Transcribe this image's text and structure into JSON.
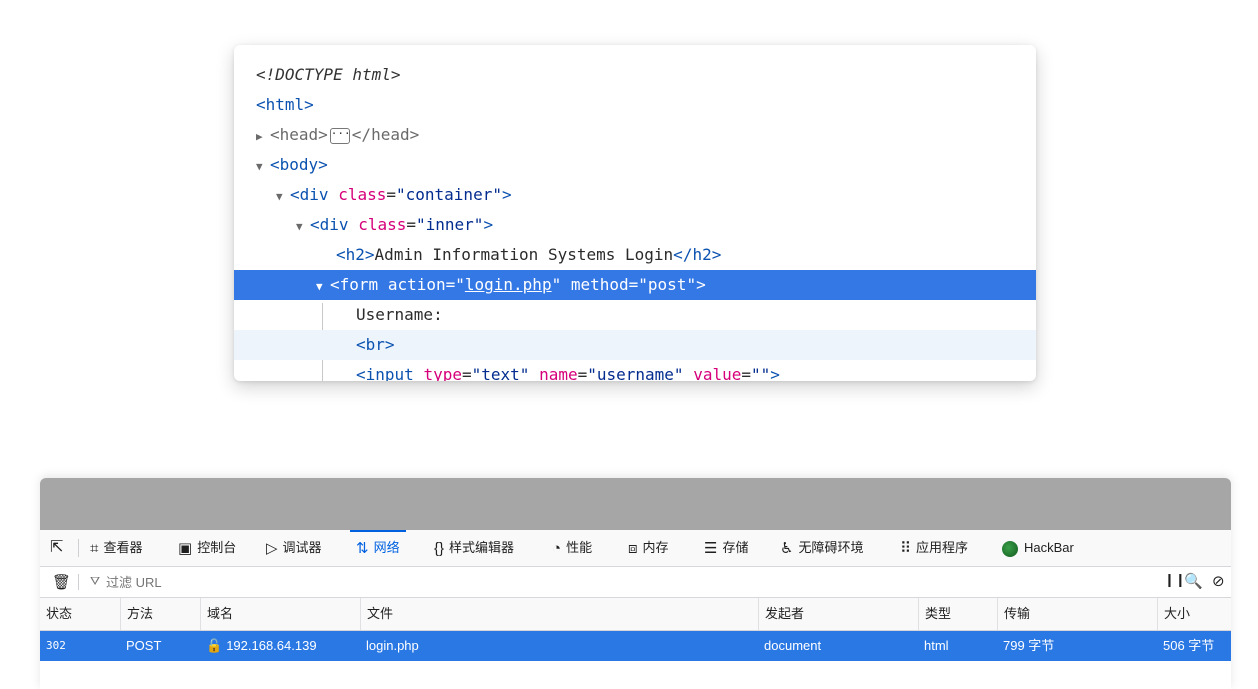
{
  "inspector": {
    "doctype": "<!DOCTYPE html>",
    "html_tag": "html",
    "head_open": "<head>",
    "head_close": "</head>",
    "ellipsis": "···",
    "body_tag": "body",
    "div1_tag": "div",
    "div1_attr": "class",
    "div1_val": "\"container\"",
    "div2_tag": "div",
    "div2_attr": "class",
    "div2_val": "\"inner\"",
    "h2_open": "h2",
    "h2_text": "Admin Information Systems Login",
    "h2_close": "/h2",
    "form_tag": "form",
    "form_attr1": "action",
    "form_val1": "login.php",
    "form_attr2": "method",
    "form_val2": "\"post\"",
    "text_username": "Username:",
    "br_tag": "br",
    "input_tag": "input",
    "input_attr1": "type",
    "input_val1": "\"text\"",
    "input_attr2": "name",
    "input_val2": "\"username\"",
    "input_attr3": "value",
    "input_val3": "\"\""
  },
  "devtools": {
    "tabs": [
      {
        "label": "查看器",
        "icon": "inspector-icon"
      },
      {
        "label": "控制台",
        "icon": "console-icon"
      },
      {
        "label": "调试器",
        "icon": "debugger-icon"
      },
      {
        "label": "网络",
        "icon": "network-icon",
        "active": true
      },
      {
        "label": "样式编辑器",
        "icon": "style-editor-icon"
      },
      {
        "label": "性能",
        "icon": "performance-icon"
      },
      {
        "label": "内存",
        "icon": "memory-icon"
      },
      {
        "label": "存储",
        "icon": "storage-icon"
      },
      {
        "label": "无障碍环境",
        "icon": "accessibility-icon"
      },
      {
        "label": "应用程序",
        "icon": "application-icon"
      },
      {
        "label": "HackBar",
        "icon": "hackbar-icon"
      }
    ],
    "filter_placeholder": "过滤 URL",
    "columns": [
      "状态",
      "方法",
      "域名",
      "文件",
      "发起者",
      "类型",
      "传输",
      "大小"
    ],
    "row": {
      "status": "302",
      "method": "POST",
      "domain": "192.168.64.139",
      "file": "login.php",
      "initiator": "document",
      "type": "html",
      "transferred": "799 字节",
      "size": "506 字节"
    },
    "accent_color": "#0061e0",
    "selected_row_color": "#2a78e4"
  }
}
